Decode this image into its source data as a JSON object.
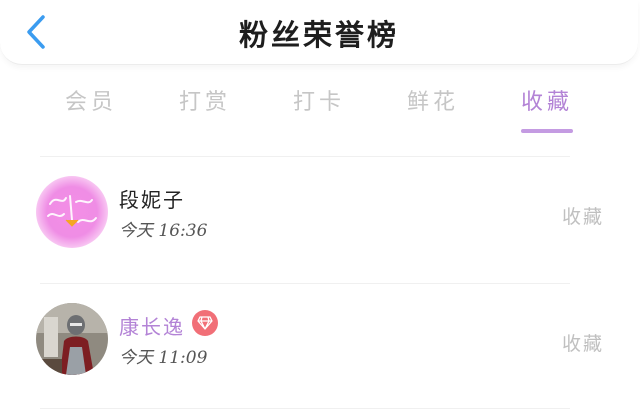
{
  "header": {
    "title": "粉丝荣誉榜",
    "back_icon": "chevron-left-icon",
    "accent": "#3b9cf0"
  },
  "tabs": [
    {
      "label": "会员",
      "active": false
    },
    {
      "label": "打赏",
      "active": false
    },
    {
      "label": "打卡",
      "active": false
    },
    {
      "label": "鲜花",
      "active": false
    },
    {
      "label": "收藏",
      "active": true
    }
  ],
  "active_color": "#b383d6",
  "entries": [
    {
      "name": "段妮子",
      "time": "今天 16:36",
      "action": "收藏",
      "vip": false,
      "avatar": "pink-handwriting-avatar"
    },
    {
      "name": "康长逸",
      "time": "今天 11:09",
      "action": "收藏",
      "vip": true,
      "badge_icon": "diamond-icon",
      "avatar": "character-photo-avatar"
    }
  ]
}
